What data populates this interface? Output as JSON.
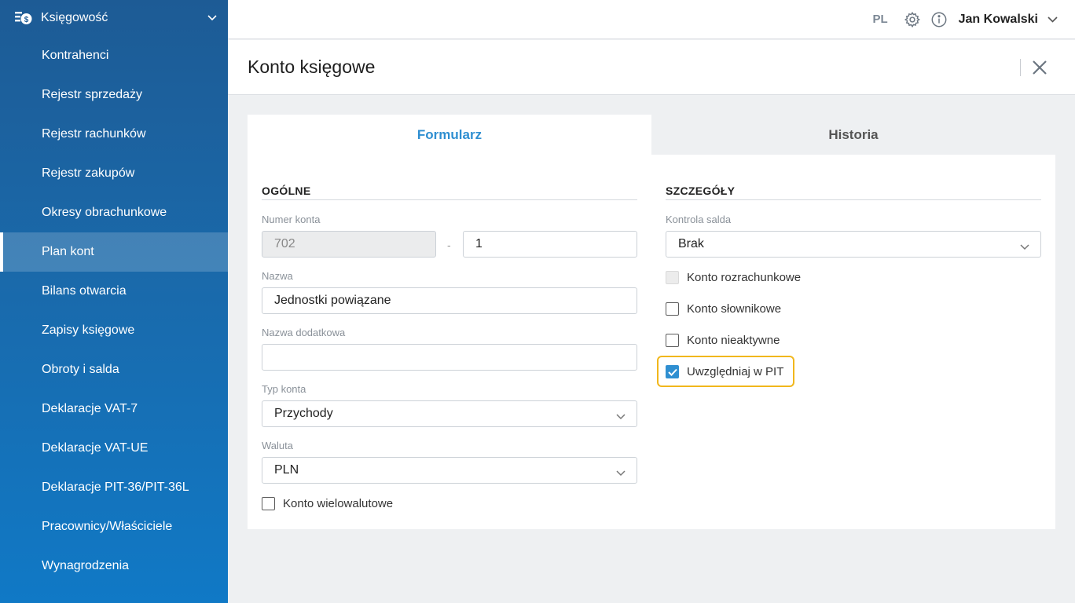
{
  "sidebar": {
    "header": "Księgowość",
    "items": [
      {
        "label": "Kontrahenci"
      },
      {
        "label": "Rejestr sprzedaży"
      },
      {
        "label": "Rejestr rachunków"
      },
      {
        "label": "Rejestr zakupów"
      },
      {
        "label": "Okresy obrachunkowe"
      },
      {
        "label": "Plan kont",
        "active": true
      },
      {
        "label": "Bilans otwarcia"
      },
      {
        "label": "Zapisy księgowe"
      },
      {
        "label": "Obroty i salda"
      },
      {
        "label": "Deklaracje VAT-7"
      },
      {
        "label": "Deklaracje VAT-UE"
      },
      {
        "label": "Deklaracje PIT-36/PIT-36L"
      },
      {
        "label": "Pracownicy/Właściciele"
      },
      {
        "label": "Wynagrodzenia"
      }
    ]
  },
  "topbar": {
    "lang": "PL",
    "user": "Jan Kowalski",
    "icons": [
      "gear-icon",
      "info-icon",
      "chevron-down-icon"
    ]
  },
  "page": {
    "title": "Konto księgowe"
  },
  "tabs": [
    {
      "label": "Formularz",
      "active": true
    },
    {
      "label": "Historia",
      "active": false
    }
  ],
  "general": {
    "title": "OGÓLNE",
    "account_number_label": "Numer konta",
    "account_prefix": "702",
    "account_separator": "-",
    "account_suffix": "1",
    "name_label": "Nazwa",
    "name_value": "Jednostki powiązane",
    "extra_name_label": "Nazwa dodatkowa",
    "extra_name_value": "",
    "type_label": "Typ konta",
    "type_value": "Przychody",
    "currency_label": "Waluta",
    "currency_value": "PLN",
    "multicurrency_label": "Konto wielowalutowe",
    "multicurrency_checked": false
  },
  "details": {
    "title": "SZCZEGÓŁY",
    "balance_control_label": "Kontrola salda",
    "balance_control_value": "Brak",
    "checkboxes": [
      {
        "label": "Konto rozrachunkowe",
        "checked": false,
        "disabled": true
      },
      {
        "label": "Konto słownikowe",
        "checked": false,
        "disabled": false
      },
      {
        "label": "Konto nieaktywne",
        "checked": false,
        "disabled": false
      },
      {
        "label": "Uwzględniaj w PIT",
        "checked": true,
        "disabled": false
      }
    ]
  },
  "colors": {
    "accent": "#2f8fd1",
    "highlight": "#f1b71c",
    "sidebar_top": "#1d5b95",
    "sidebar_bottom": "#1079c6"
  }
}
